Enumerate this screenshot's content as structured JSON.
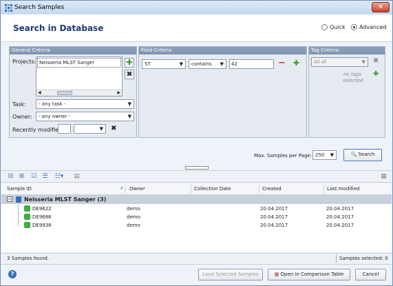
{
  "window": {
    "title": "Search Samples"
  },
  "header": {
    "title": "Search in Database",
    "mode_quick": "Quick",
    "mode_advanced": "Advanced",
    "selected_mode": "Advanced"
  },
  "general_criteria": {
    "title": "General Criteria",
    "projects_label": "Projects:",
    "projects": [
      "Neisseria MLST Sanger"
    ],
    "task_label": "Task:",
    "task_value": "- any task -",
    "owner_label": "Owner:",
    "owner_value": "- any owner -",
    "recent_label": "Recently modified:"
  },
  "field_criteria": {
    "title": "Field Criteria",
    "field": "ST",
    "operator": "contains",
    "value": "42"
  },
  "tag_criteria": {
    "title": "Tag Criteria",
    "mode": "All of",
    "empty_text_1": "no tags",
    "empty_text_2": "selected"
  },
  "search": {
    "max_label": "Max. Samples per Page:",
    "max_value": "250",
    "button": "Search"
  },
  "table": {
    "columns": [
      "Sample ID",
      "Owner",
      "Collection Date",
      "Created",
      "Last modified"
    ],
    "group": "Neisseria MLST Sanger (3)",
    "rows": [
      {
        "id": "DE9622",
        "owner": "demo",
        "collection": "",
        "created": "20.04.2017",
        "modified": "20.04.2017"
      },
      {
        "id": "DE9686",
        "owner": "demo",
        "collection": "",
        "created": "20.04.2017",
        "modified": "20.04.2017"
      },
      {
        "id": "DE9938",
        "owner": "demo",
        "collection": "",
        "created": "20.04.2017",
        "modified": "20.04.2017"
      }
    ]
  },
  "status": {
    "found": "3 Samples found.",
    "selected": "Samples selected: 0"
  },
  "footer": {
    "load": "Load Selected Samples",
    "compare": "Open in Comparison Table",
    "cancel": "Cancel"
  }
}
